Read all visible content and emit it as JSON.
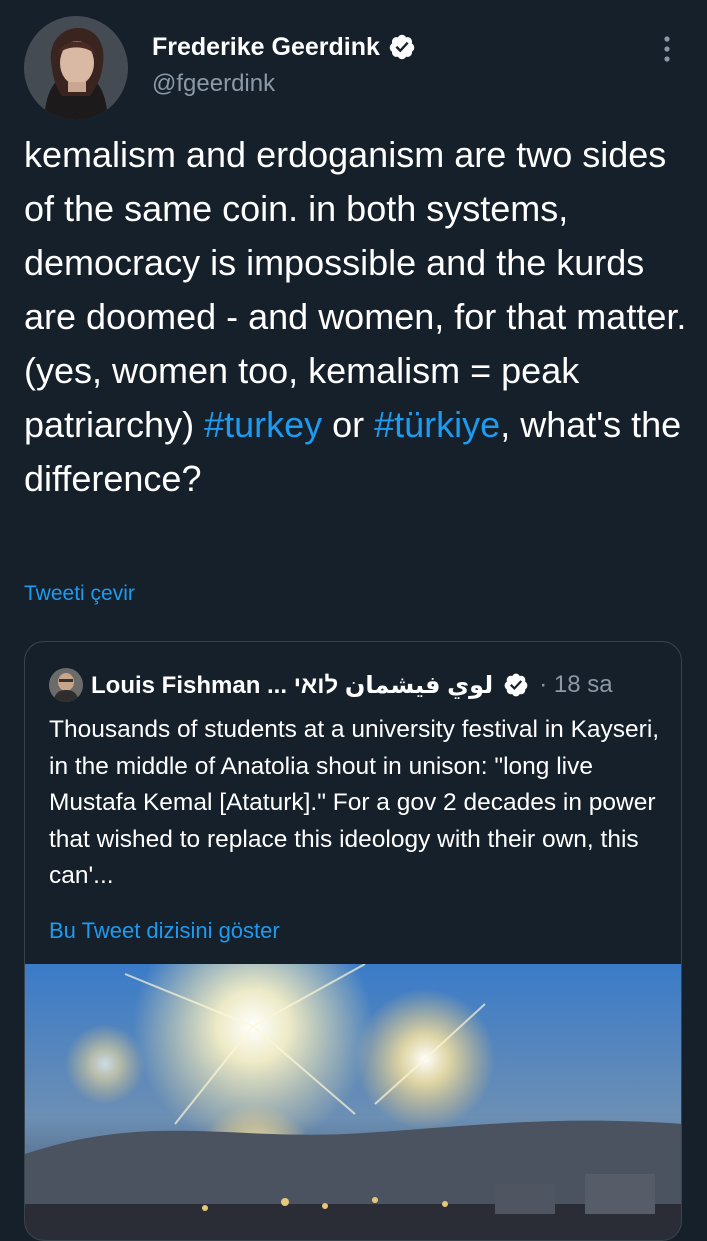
{
  "author": {
    "display_name": "Frederike Geerdink",
    "handle": "@fgeerdink"
  },
  "tweet": {
    "text_before": "kemalism and erdoganism are two sides of the same coin. in both systems, democracy is impossible and the kurds are doomed - and women, for that matter. (yes, women too, kemalism = peak patriarchy) ",
    "hashtag_1": "#turkey",
    "text_middle": " or ",
    "hashtag_2": "#türkiye",
    "text_after": ", what's the difference?",
    "translate_label": "Tweeti çevir"
  },
  "quoted": {
    "display_name": "Louis Fishman ... لوي فيشمان לואי",
    "time": "· 18 sa",
    "text": "Thousands of students at a university festival in Kayseri, in the middle of Anatolia shout in unison: \"long live Mustafa Kemal [Ataturk].\" For a gov 2 decades in power that wished to replace this ideology with their own, this can'...",
    "thread_label": "Bu Tweet dizisini göster"
  },
  "icons": {
    "verified": "verified-badge-icon",
    "more": "more-vertical-icon"
  },
  "colors": {
    "background": "#15202b",
    "accent": "#1d9bf0",
    "secondary_text": "#8b98a5",
    "border": "#38444d"
  }
}
